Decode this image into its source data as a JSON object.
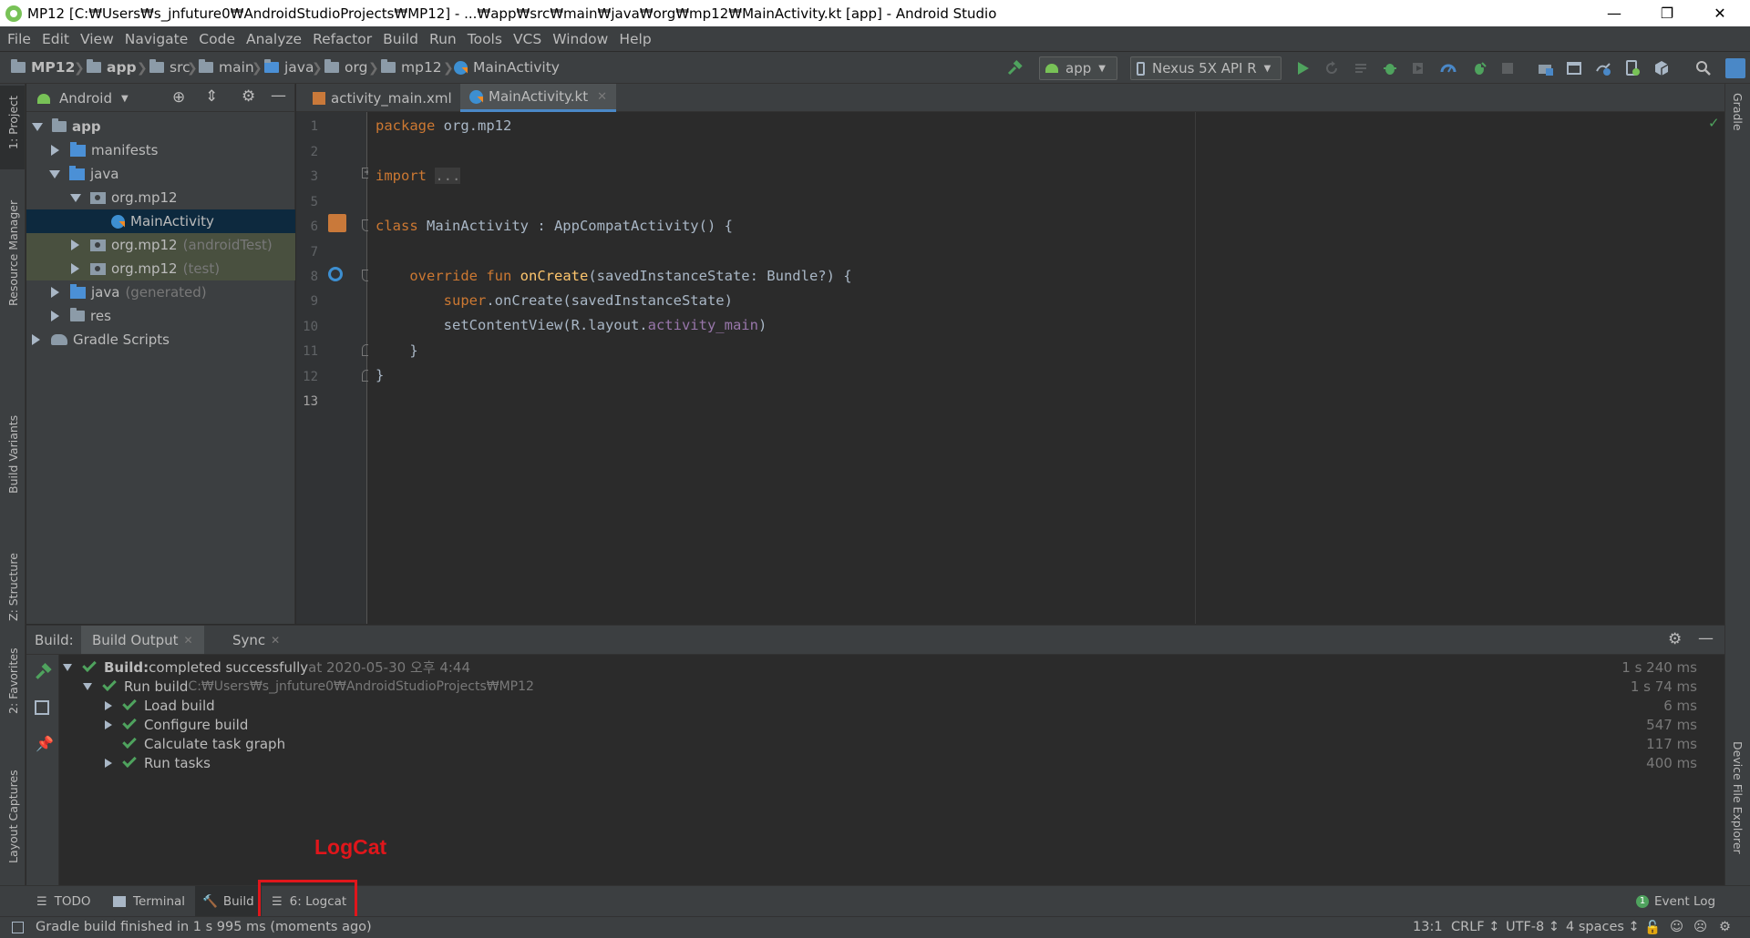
{
  "window": {
    "title": "MP12 [C:₩Users₩s_jnfuture0₩AndroidStudioProjects₩MP12] - ...₩app₩src₩main₩java₩org₩mp12₩MainActivity.kt [app] - Android Studio",
    "minimize": "—",
    "restore": "❐",
    "close": "✕"
  },
  "menu": [
    "File",
    "Edit",
    "View",
    "Navigate",
    "Code",
    "Analyze",
    "Refactor",
    "Build",
    "Run",
    "Tools",
    "VCS",
    "Window",
    "Help"
  ],
  "breadcrumbs": [
    "MP12",
    "app",
    "src",
    "main",
    "java",
    "org",
    "mp12",
    "MainActivity"
  ],
  "toolbar": {
    "config": "app",
    "device": "Nexus 5X API R"
  },
  "project_panel": {
    "view": "Android",
    "tree": [
      {
        "label": "app",
        "bold": true
      },
      {
        "label": "manifests"
      },
      {
        "label": "java"
      },
      {
        "label": "org.mp12"
      },
      {
        "label": "MainActivity"
      },
      {
        "label": "org.mp12",
        "suffix": "(androidTest)"
      },
      {
        "label": "org.mp12",
        "suffix": "(test)"
      },
      {
        "label": "java",
        "suffix": "(generated)"
      },
      {
        "label": "res"
      },
      {
        "label": "Gradle Scripts"
      }
    ]
  },
  "editor": {
    "tabs": [
      {
        "label": "activity_main.xml",
        "active": false
      },
      {
        "label": "MainActivity.kt",
        "active": true
      }
    ],
    "line_numbers": [
      "1",
      "2",
      "3",
      "5",
      "6",
      "7",
      "8",
      "9",
      "10",
      "11",
      "12",
      "13"
    ],
    "code": {
      "l1_kw": "package",
      "l1_rest": " org.mp12",
      "l3_kw": "import",
      "l3_fold": "...",
      "l6_kw": "class",
      "l6_rest": " MainActivity : AppCompatActivity() {",
      "l8_kw1": "override",
      "l8_kw2": "fun",
      "l8_fn": "onCreate",
      "l8_rest": "(savedInstanceState: Bundle?) {",
      "l9_kw": "super",
      "l9_rest": ".onCreate(savedInstanceState)",
      "l10_pre": "setContentView(R.layout.",
      "l10_prop": "activity_main",
      "l10_post": ")",
      "l11": "}",
      "l12": "}"
    }
  },
  "build_panel": {
    "label": "Build:",
    "tabs": [
      "Build Output",
      "Sync"
    ],
    "rows": [
      {
        "bold": "Build:",
        "text": " completed successfully",
        "muted": " at 2020-05-30 오후 4:44",
        "time": "1 s 240 ms"
      },
      {
        "text": "Run build",
        "muted": " C:₩Users₩s_jnfuture0₩AndroidStudioProjects₩MP12",
        "time": "1 s 74 ms"
      },
      {
        "text": "Load build",
        "time": "6 ms"
      },
      {
        "text": "Configure build",
        "time": "547 ms"
      },
      {
        "text": "Calculate task graph",
        "time": "117 ms"
      },
      {
        "text": "Run tasks",
        "time": "400 ms"
      }
    ]
  },
  "left_stripe": [
    "1: Project",
    "Resource Manager",
    "Build Variants",
    "Z: Structure",
    "2: Favorites",
    "Layout Captures"
  ],
  "right_stripe": [
    "Gradle",
    "Device File Explorer"
  ],
  "bottom_tabs": [
    "TODO",
    "Terminal",
    "Build",
    "6: Logcat"
  ],
  "event_log": {
    "count": "1",
    "label": "Event Log"
  },
  "status": {
    "message": "Gradle build finished in 1 s 995 ms (moments ago)",
    "position": "13:1",
    "line_sep": "CRLF ↕",
    "encoding": "UTF-8 ↕",
    "indent": "4 spaces ↕"
  },
  "annotation": {
    "text": "LogCat",
    "color": "#e0161b"
  },
  "colors": {
    "accent": "#4a88c7",
    "success": "#4fa35e",
    "keyword": "#cc7832",
    "function": "#ffc66d",
    "property": "#9876aa"
  }
}
